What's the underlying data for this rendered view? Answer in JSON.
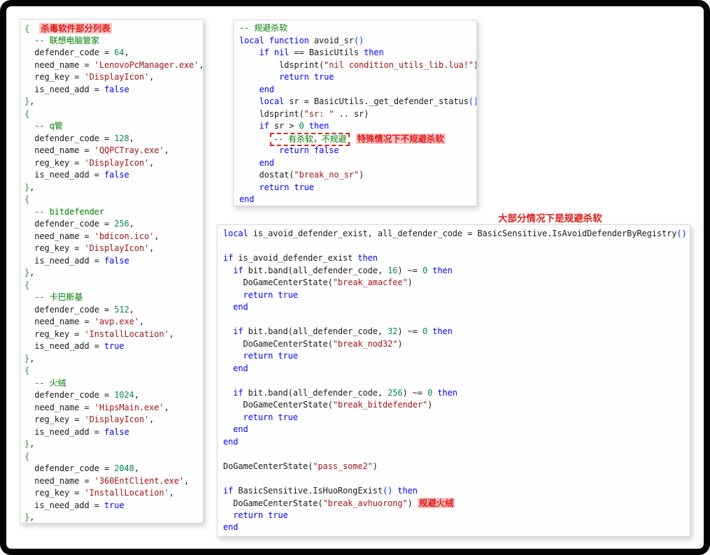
{
  "annotations": {
    "most_cases": "大部分情况下是规避杀软"
  },
  "left_panel": {
    "lines": [
      [
        [
          "b",
          "{"
        ],
        [
          "t",
          "  "
        ],
        [
          "hl",
          "杀毒软件部分列表"
        ]
      ],
      [
        [
          "t",
          "  "
        ],
        [
          "c",
          "-- 联想电脑管家"
        ]
      ],
      [
        [
          "t",
          "  defender_code = "
        ],
        [
          "n",
          "64"
        ],
        [
          "t",
          ","
        ]
      ],
      [
        [
          "t",
          "  need_name = "
        ],
        [
          "s",
          "'LenovoPcManager.exe'"
        ],
        [
          "t",
          ","
        ]
      ],
      [
        [
          "t",
          "  reg_key = "
        ],
        [
          "s",
          "'DisplayIcon'"
        ],
        [
          "t",
          ","
        ]
      ],
      [
        [
          "t",
          "  is_need_add = "
        ],
        [
          "k",
          "false"
        ]
      ],
      [
        [
          "b",
          "}"
        ],
        [
          "t",
          ","
        ]
      ],
      [
        [
          "b",
          "{"
        ]
      ],
      [
        [
          "t",
          "  "
        ],
        [
          "c",
          "-- q管"
        ]
      ],
      [
        [
          "t",
          "  defender_code = "
        ],
        [
          "n",
          "128"
        ],
        [
          "t",
          ","
        ]
      ],
      [
        [
          "t",
          "  need_name = "
        ],
        [
          "s",
          "'QQPCTray.exe'"
        ],
        [
          "t",
          ","
        ]
      ],
      [
        [
          "t",
          "  reg_key = "
        ],
        [
          "s",
          "'DisplayIcon'"
        ],
        [
          "t",
          ","
        ]
      ],
      [
        [
          "t",
          "  is_need_add = "
        ],
        [
          "k",
          "false"
        ]
      ],
      [
        [
          "b",
          "}"
        ],
        [
          "t",
          ","
        ]
      ],
      [
        [
          "b",
          "{"
        ]
      ],
      [
        [
          "t",
          "  "
        ],
        [
          "c",
          "-- bitdefender"
        ]
      ],
      [
        [
          "t",
          "  defender_code = "
        ],
        [
          "n",
          "256"
        ],
        [
          "t",
          ","
        ]
      ],
      [
        [
          "t",
          "  need_name = "
        ],
        [
          "s",
          "'bdicon.ico'"
        ],
        [
          "t",
          ","
        ]
      ],
      [
        [
          "t",
          "  reg_key = "
        ],
        [
          "s",
          "'DisplayIcon'"
        ],
        [
          "t",
          ","
        ]
      ],
      [
        [
          "t",
          "  is_need_add = "
        ],
        [
          "k",
          "false"
        ]
      ],
      [
        [
          "b",
          "}"
        ],
        [
          "t",
          ","
        ]
      ],
      [
        [
          "b",
          "{"
        ]
      ],
      [
        [
          "t",
          "  "
        ],
        [
          "c",
          "-- 卡巴斯基"
        ]
      ],
      [
        [
          "t",
          "  defender_code = "
        ],
        [
          "n",
          "512"
        ],
        [
          "t",
          ","
        ]
      ],
      [
        [
          "t",
          "  need_name = "
        ],
        [
          "s",
          "'avp.exe'"
        ],
        [
          "t",
          ","
        ]
      ],
      [
        [
          "t",
          "  reg_key = "
        ],
        [
          "s",
          "'InstallLocation'"
        ],
        [
          "t",
          ","
        ]
      ],
      [
        [
          "t",
          "  is_need_add = "
        ],
        [
          "k",
          "true"
        ]
      ],
      [
        [
          "b",
          "}"
        ],
        [
          "t",
          ","
        ]
      ],
      [
        [
          "b",
          "{"
        ]
      ],
      [
        [
          "t",
          "  "
        ],
        [
          "c",
          "-- 火绒"
        ]
      ],
      [
        [
          "t",
          "  defender_code = "
        ],
        [
          "n",
          "1024"
        ],
        [
          "t",
          ","
        ]
      ],
      [
        [
          "t",
          "  need_name = "
        ],
        [
          "s",
          "'HipsMain.exe'"
        ],
        [
          "t",
          ","
        ]
      ],
      [
        [
          "t",
          "  reg_key = "
        ],
        [
          "s",
          "'DisplayIcon'"
        ],
        [
          "t",
          ","
        ]
      ],
      [
        [
          "t",
          "  is_need_add = "
        ],
        [
          "k",
          "false"
        ]
      ],
      [
        [
          "b",
          "}"
        ],
        [
          "t",
          ","
        ]
      ],
      [
        [
          "b",
          "{"
        ]
      ],
      [
        [
          "t",
          "  defender_code = "
        ],
        [
          "n",
          "2048"
        ],
        [
          "t",
          ","
        ]
      ],
      [
        [
          "t",
          "  need_name = "
        ],
        [
          "s",
          "'360EntClient.exe'"
        ],
        [
          "t",
          ","
        ]
      ],
      [
        [
          "t",
          "  reg_key = "
        ],
        [
          "s",
          "'InstallLocation'"
        ],
        [
          "t",
          ","
        ]
      ],
      [
        [
          "t",
          "  is_need_add = "
        ],
        [
          "k",
          "true"
        ]
      ],
      [
        [
          "b",
          "}"
        ],
        [
          "t",
          ","
        ]
      ]
    ]
  },
  "top_right_panel": {
    "lines": [
      [
        [
          "c",
          "-- 规避杀软"
        ]
      ],
      [
        [
          "k",
          "local"
        ],
        [
          "t",
          " "
        ],
        [
          "k",
          "function"
        ],
        [
          "t",
          " avoid_sr"
        ],
        [
          "p",
          "()"
        ]
      ],
      [
        [
          "t",
          "    "
        ],
        [
          "k",
          "if"
        ],
        [
          "t",
          " "
        ],
        [
          "k",
          "nil"
        ],
        [
          "t",
          " == BasicUtils "
        ],
        [
          "k",
          "then"
        ]
      ],
      [
        [
          "t",
          "        ldsprint("
        ],
        [
          "s",
          "\"nil condition_utils_lib.lua!\""
        ],
        [
          "t",
          ")"
        ]
      ],
      [
        [
          "t",
          "        "
        ],
        [
          "k",
          "return"
        ],
        [
          "t",
          " "
        ],
        [
          "k",
          "true"
        ]
      ],
      [
        [
          "t",
          "    "
        ],
        [
          "k",
          "end"
        ]
      ],
      [
        [
          "t",
          "    "
        ],
        [
          "k",
          "local"
        ],
        [
          "t",
          " sr = BasicUtils._get_defender_status"
        ],
        [
          "p",
          "()"
        ]
      ],
      [
        [
          "t",
          "    ldsprint("
        ],
        [
          "s",
          "\"sr: \""
        ],
        [
          "t",
          " .. sr)"
        ]
      ],
      [
        [
          "t",
          "    "
        ],
        [
          "k",
          "if"
        ],
        [
          "t",
          " sr > "
        ],
        [
          "n",
          "0"
        ],
        [
          "t",
          " "
        ],
        [
          "k",
          "then"
        ]
      ],
      [
        [
          "t",
          "      "
        ],
        [
          "box",
          "-- 有杀软，不规避"
        ],
        [
          "t",
          " "
        ],
        [
          "hl",
          "特殊情况下不规避杀软"
        ]
      ],
      [
        [
          "t",
          "        "
        ],
        [
          "k",
          "return"
        ],
        [
          "t",
          " "
        ],
        [
          "k",
          "false"
        ]
      ],
      [
        [
          "t",
          "    "
        ],
        [
          "k",
          "end"
        ]
      ],
      [
        [
          "t",
          "    dostat("
        ],
        [
          "s",
          "\"break_no_sr\""
        ],
        [
          "t",
          ")"
        ]
      ],
      [
        [
          "t",
          "    "
        ],
        [
          "k",
          "return"
        ],
        [
          "t",
          " "
        ],
        [
          "k",
          "true"
        ]
      ],
      [
        [
          "k",
          "end"
        ]
      ]
    ]
  },
  "bottom_right_panel": {
    "lines": [
      [
        [
          "k",
          "local"
        ],
        [
          "t",
          " is_avoid_defender_exist, all_defender_code = BasicSensitive.IsAvoidDefenderByRegistry"
        ],
        [
          "p",
          "()"
        ]
      ],
      [],
      [
        [
          "k",
          "if"
        ],
        [
          "t",
          " is_avoid_defender_exist "
        ],
        [
          "k",
          "then"
        ]
      ],
      [
        [
          "t",
          "  "
        ],
        [
          "k",
          "if"
        ],
        [
          "t",
          " bit.band(all_defender_code, "
        ],
        [
          "n",
          "16"
        ],
        [
          "t",
          ") ~= "
        ],
        [
          "n",
          "0"
        ],
        [
          "t",
          " "
        ],
        [
          "k",
          "then"
        ]
      ],
      [
        [
          "t",
          "    DoGameCenterState("
        ],
        [
          "s",
          "\"break_amacfee\""
        ],
        [
          "t",
          ")"
        ]
      ],
      [
        [
          "t",
          "    "
        ],
        [
          "k",
          "return"
        ],
        [
          "t",
          " "
        ],
        [
          "k",
          "true"
        ]
      ],
      [
        [
          "t",
          "  "
        ],
        [
          "k",
          "end"
        ]
      ],
      [],
      [
        [
          "t",
          "  "
        ],
        [
          "k",
          "if"
        ],
        [
          "t",
          " bit.band(all_defender_code, "
        ],
        [
          "n",
          "32"
        ],
        [
          "t",
          ") ~= "
        ],
        [
          "n",
          "0"
        ],
        [
          "t",
          " "
        ],
        [
          "k",
          "then"
        ]
      ],
      [
        [
          "t",
          "    DoGameCenterState("
        ],
        [
          "s",
          "\"break_nod32\""
        ],
        [
          "t",
          ")"
        ]
      ],
      [
        [
          "t",
          "    "
        ],
        [
          "k",
          "return"
        ],
        [
          "t",
          " "
        ],
        [
          "k",
          "true"
        ]
      ],
      [
        [
          "t",
          "  "
        ],
        [
          "k",
          "end"
        ]
      ],
      [],
      [
        [
          "t",
          "  "
        ],
        [
          "k",
          "if"
        ],
        [
          "t",
          " bit.band(all_defender_code, "
        ],
        [
          "n",
          "256"
        ],
        [
          "t",
          ") ~= "
        ],
        [
          "n",
          "0"
        ],
        [
          "t",
          " "
        ],
        [
          "k",
          "then"
        ]
      ],
      [
        [
          "t",
          "    DoGameCenterState("
        ],
        [
          "s",
          "\"break_bitdefender\""
        ],
        [
          "t",
          ")"
        ]
      ],
      [
        [
          "t",
          "    "
        ],
        [
          "k",
          "return"
        ],
        [
          "t",
          " "
        ],
        [
          "k",
          "true"
        ]
      ],
      [
        [
          "t",
          "  "
        ],
        [
          "k",
          "end"
        ]
      ],
      [
        [
          "k",
          "end"
        ]
      ],
      [],
      [
        [
          "t",
          "DoGameCenterState("
        ],
        [
          "s",
          "\"pass_some2\""
        ],
        [
          "t",
          ")"
        ]
      ],
      [],
      [
        [
          "k",
          "if"
        ],
        [
          "t",
          " BasicSensitive.IsHuoRongExist"
        ],
        [
          "p",
          "()"
        ],
        [
          "t",
          " "
        ],
        [
          "k",
          "then"
        ]
      ],
      [
        [
          "t",
          "  DoGameCenterState("
        ],
        [
          "s",
          "\"break_avhuorong\""
        ],
        [
          "t",
          ") "
        ],
        [
          "hl",
          "规避火绒"
        ]
      ],
      [
        [
          "t",
          "  "
        ],
        [
          "k",
          "return"
        ],
        [
          "t",
          " "
        ],
        [
          "k",
          "true"
        ]
      ],
      [
        [
          "k",
          "end"
        ]
      ]
    ]
  },
  "colors": {
    "keyword": "#0000ff",
    "string": "#a31515",
    "number": "#098658",
    "comment": "#008000",
    "annotation_red": "#e01b1b",
    "annotation_highlight": "#f6c6c6",
    "frame": "#050505"
  }
}
